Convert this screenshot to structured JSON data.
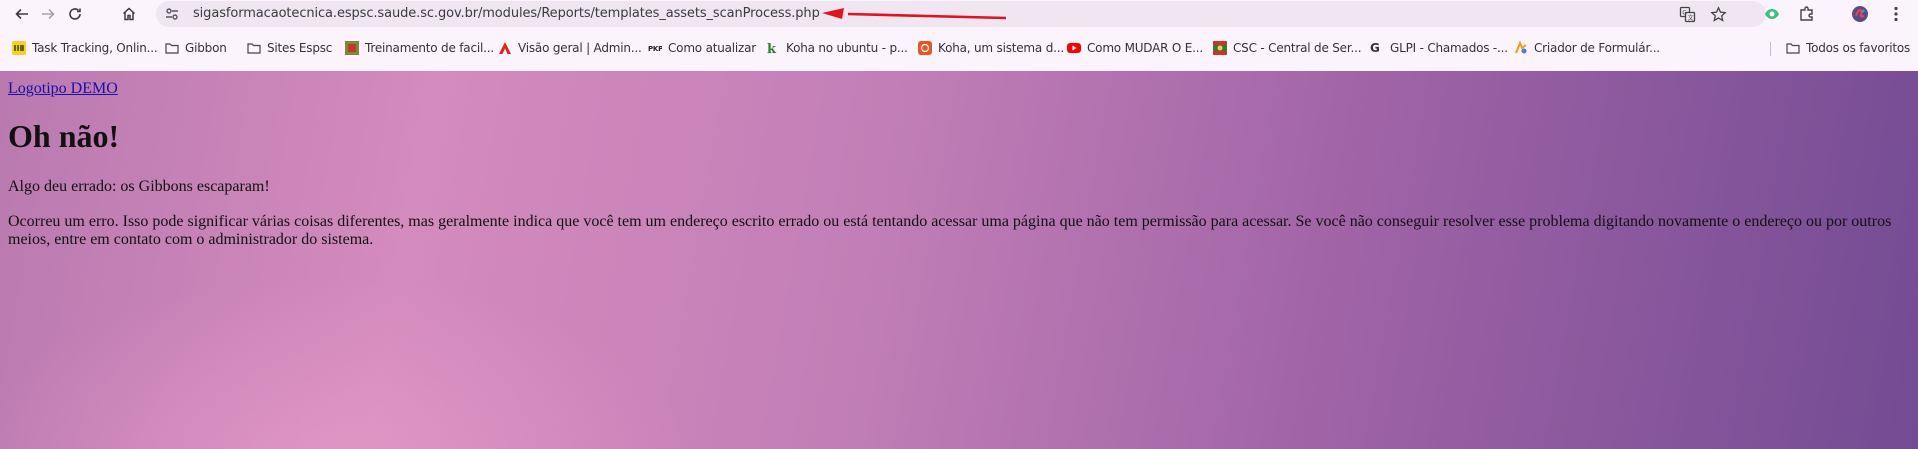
{
  "browser": {
    "url": "sigasformacaotecnica.espsc.saude.sc.gov.br/modules/Reports/templates_assets_scanProcess.php",
    "nav": {
      "back_icon": "arrow-left-icon",
      "forward_icon": "arrow-right-icon",
      "reload_icon": "reload-icon",
      "home_icon": "home-icon"
    },
    "bookmarks": [
      {
        "label": "Task Tracking, Onlin...",
        "icon": "task-tracking-icon"
      },
      {
        "label": "Gibbon",
        "icon": "folder-icon"
      },
      {
        "label": "Sites Espsc",
        "icon": "folder-icon"
      },
      {
        "label": "Treinamento de facil...",
        "icon": "training-icon"
      },
      {
        "label": "Visão geral | Admin...",
        "icon": "admin-icon"
      },
      {
        "label": "Como atualizar",
        "icon": "pkp-icon"
      },
      {
        "label": "Koha no ubuntu - p...",
        "icon": "koha-icon"
      },
      {
        "label": "Koha, um sistema d...",
        "icon": "ubuntu-icon"
      },
      {
        "label": "Como MUDAR O E...",
        "icon": "youtube-icon"
      },
      {
        "label": "CSC - Central de Ser...",
        "icon": "csc-icon"
      },
      {
        "label": "GLPI - Chamados -...",
        "icon": "glpi-icon"
      },
      {
        "label": "Criador de Formulár...",
        "icon": "forms-icon"
      }
    ],
    "all_bookmarks": "Todos os favoritos"
  },
  "page": {
    "logo_alt": "Logotipo DEMO",
    "title": "Oh não!",
    "subtitle": "Algo deu errado: os Gibbons escaparam!",
    "message": "Ocorreu um erro. Isso pode significar várias coisas diferentes, mas geralmente indica que você tem um endereço escrito errado ou está tentando acessar uma página que não tem permissão para acessar. Se você não conseguir resolver esse problema digitando novamente o endereço ou por outros meios, entre em contato com o administrador do sistema."
  },
  "colors": {
    "annotation_arrow": "#e0141e",
    "gradient_start": "#b97ab0",
    "gradient_end": "#734b93"
  }
}
